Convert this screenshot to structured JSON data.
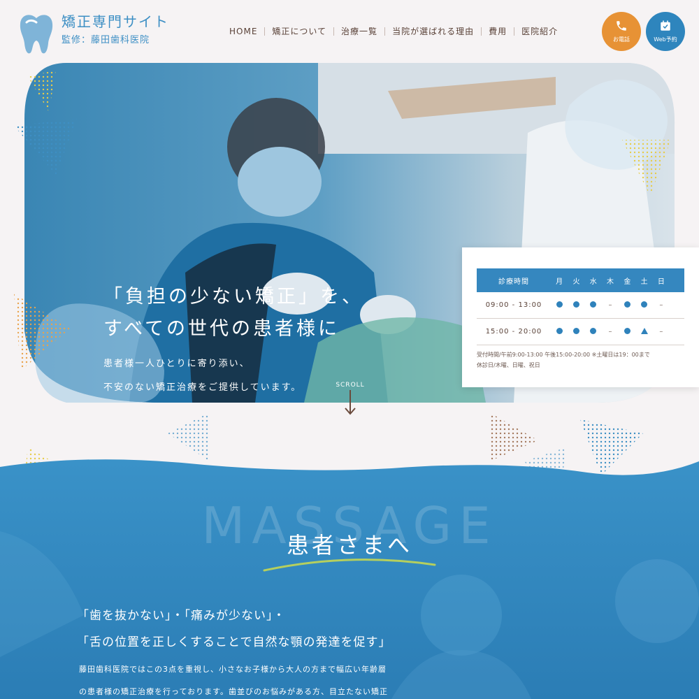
{
  "site": {
    "title": "矯正専門サイト",
    "subtitle": "監修：藤田歯科医院",
    "logo_icon": "tooth-icon"
  },
  "nav": {
    "items": [
      "HOME",
      "矯正について",
      "治療一覧",
      "当院が選ばれる理由",
      "費用",
      "医院紹介"
    ]
  },
  "cta": {
    "tel_label": "お電話",
    "tel_icon": "phone-icon",
    "web_label": "Web予約",
    "web_icon": "calendar-check-icon"
  },
  "hero": {
    "heading_line1": "「負担の少ない矯正」を、",
    "heading_line2": "すべての世代の患者様に",
    "text_line1": "患者様一人ひとりに寄り添い、",
    "text_line2": "不安のない矯正治療をご提供しています。",
    "scroll_label": "SCROLL"
  },
  "schedule": {
    "header": "診療時間",
    "days": [
      "月",
      "火",
      "水",
      "木",
      "金",
      "土",
      "日"
    ],
    "rows": [
      {
        "time": "09:00 - 13:00",
        "marks": [
          "dot",
          "dot",
          "dot",
          "dash",
          "dot",
          "dot",
          "dash"
        ]
      },
      {
        "time": "15:00 - 20:00",
        "marks": [
          "dot",
          "dot",
          "dot",
          "dash",
          "dot",
          "tri",
          "dash"
        ]
      }
    ],
    "note_line1": "受付時間/午前9:00-13:00 午後15:00-20:00 ※土曜日は19：00まで",
    "note_line2": "休診日/木曜、日曜、祝日"
  },
  "message": {
    "bg_word": "MASSAGE",
    "title": "患者さまへ",
    "lead_line1": "「歯を抜かない」・「痛みが少ない」・",
    "lead_line2": "「舌の位置を正しくすることで自然な顎の発達を促す」",
    "body_line1": "藤田歯科医院ではこの3点を重視し、小さなお子様から大人の方まで幅広い年齢層",
    "body_line2": "の患者様の矯正治療を行っております。歯並びのお悩みがある方、目立たない矯正"
  },
  "colors": {
    "brand_blue": "#3d8fc4",
    "accent_orange": "#e79235",
    "section_blue": "#2f87c0",
    "text_brown": "#5a4238",
    "underline_green": "#b5cf5e"
  }
}
